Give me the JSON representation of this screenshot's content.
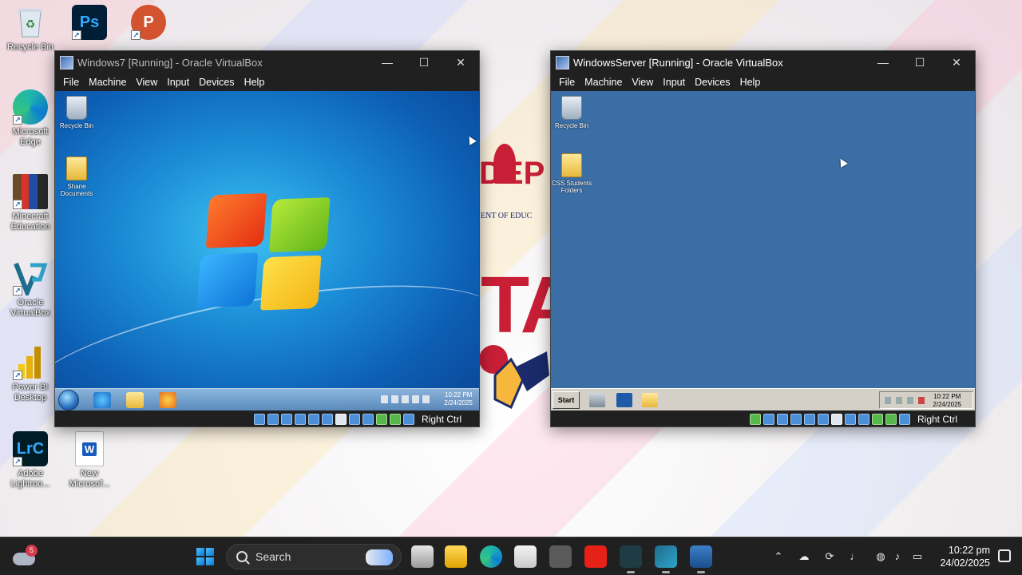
{
  "desktop": {
    "icons": [
      {
        "label": "Recycle Bin",
        "icon": "recycle-bin-icon"
      },
      {
        "label": "Adobe Photoshop",
        "icon": "photoshop-icon"
      },
      {
        "label": "PowerPoint",
        "icon": "powerpoint-icon"
      },
      {
        "label": "Microsoft Edge",
        "icon": "edge-icon"
      },
      {
        "label": "Minecraft Education",
        "icon": "minecraft-icon"
      },
      {
        "label": "Oracle VirtualBox",
        "icon": "virtualbox-icon"
      },
      {
        "label": "Power BI Desktop",
        "icon": "powerbi-icon"
      },
      {
        "label": "Adobe Lightroo...",
        "icon": "lightroom-icon"
      },
      {
        "label": "New Microsof...",
        "icon": "word-icon"
      }
    ],
    "wallpaper": {
      "brand_text": "DEP",
      "brand_sub": "ENT OF EDUC",
      "big_text": "TA",
      "brand_color": "#c81e36"
    }
  },
  "vm_left": {
    "title": "Windows7 [Running] - Oracle VirtualBox",
    "menu": [
      "File",
      "Machine",
      "View",
      "Input",
      "Devices",
      "Help"
    ],
    "host_key": "Right Ctrl",
    "guest": {
      "icons": [
        {
          "label": "Recycle Bin",
          "icon": "recycle-bin-icon"
        },
        {
          "label": "Shane Documents",
          "icon": "folder-icon"
        }
      ],
      "clock_time": "10:22 PM",
      "clock_date": "2/24/2025"
    }
  },
  "vm_right": {
    "title": "WindowsServer [Running] - Oracle VirtualBox",
    "menu": [
      "File",
      "Machine",
      "View",
      "Input",
      "Devices",
      "Help"
    ],
    "host_key": "Right Ctrl",
    "guest": {
      "icons": [
        {
          "label": "Recycle Bin",
          "icon": "recycle-bin-icon"
        },
        {
          "label": "CSS Students Folders",
          "icon": "folder-icon"
        }
      ],
      "start_label": "Start",
      "clock_time": "10:22 PM",
      "clock_date": "2/24/2025"
    }
  },
  "window_controls": {
    "minimize": "—",
    "maximize": "☐",
    "close": "✕"
  },
  "taskbar": {
    "weather_badge": "5",
    "search_label": "Search",
    "clock_time": "10:22 pm",
    "clock_date": "24/02/2025",
    "tray": [
      "chevron-up-icon",
      "network-off-icon",
      "sync-icon",
      "microphone-icon",
      "globe-icon",
      "volume-icon",
      "battery-icon"
    ],
    "apps": [
      "task-view-icon",
      "file-explorer-icon",
      "edge-icon",
      "store-icon",
      "camera-icon",
      "youtube-icon",
      "app-icon",
      "virtualbox-icon",
      "vm-2008-icon"
    ]
  },
  "colors": {
    "taskbar_bg": "#202020",
    "vbox_chrome": "#202020",
    "win7_blue": "#1c8ed8",
    "server_desktop": "#3b6ea5"
  }
}
